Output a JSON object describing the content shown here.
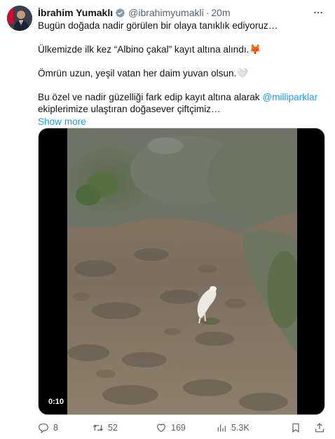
{
  "author": {
    "name": "İbrahim Yumaklı",
    "handle": "@ibrahimyumakli",
    "separator": "·",
    "time": "20m"
  },
  "tweet": {
    "lines": [
      "Bugün doğada nadir görülen bir olaya tanıklık ediyoruz…",
      "",
      "Ülkemizde ilk kez “Albino çakal” kayıt altına alındı.🦊",
      "",
      "Ömrün uzun, yeşil vatan her daim yuvan olsun.🤍",
      "",
      "Bu özel ve nadir güzelliği fark edip kayıt altına alarak "
    ],
    "mention": "@milliparklar",
    "last_line": "ekiplerimize ulaştıran doğasever çiftçimiz…",
    "show_more": "Show more"
  },
  "media": {
    "duration": "0:10"
  },
  "actions": {
    "replies": "8",
    "retweets": "52",
    "likes": "169",
    "views": "5.3K"
  },
  "colors": {
    "accent": "#1d9bf0",
    "muted": "#536471",
    "text": "#0f1419"
  },
  "icons": [
    "verified-badge-icon",
    "more-icon",
    "reply-icon",
    "retweet-icon",
    "like-icon",
    "views-icon",
    "bookmark-icon",
    "share-icon"
  ]
}
